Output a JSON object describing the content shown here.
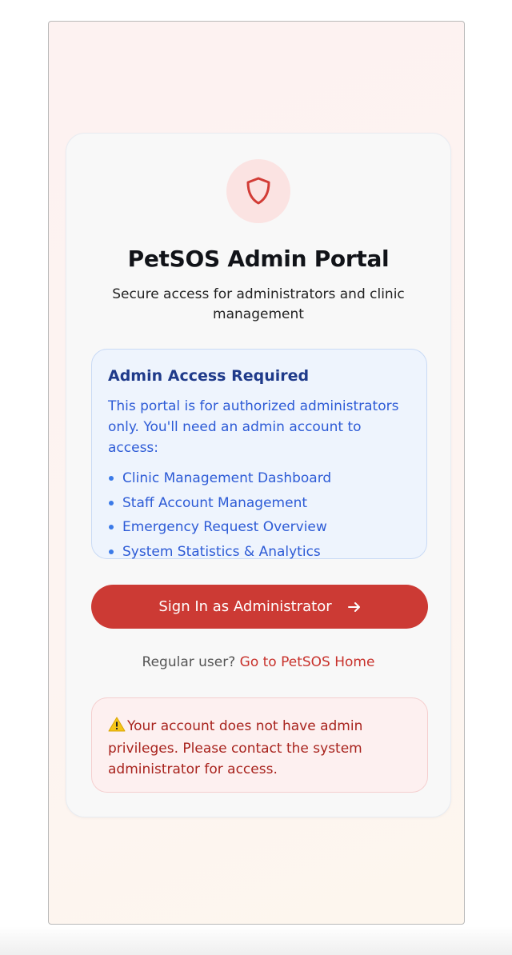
{
  "portal": {
    "title": "PetSOS Admin Portal",
    "subtitle": "Secure access for administrators and clinic management"
  },
  "info": {
    "heading": "Admin Access Required",
    "text": "This portal is for authorized administrators only. You'll need an admin account to access:",
    "items": [
      "Clinic Management Dashboard",
      "Staff Account Management",
      "Emergency Request Overview",
      "System Statistics & Analytics"
    ]
  },
  "signin": {
    "label": "Sign In as Administrator",
    "icon": "arrow-right-icon"
  },
  "regular": {
    "prompt": "Regular user?",
    "link": "Go to PetSOS Home"
  },
  "warning": {
    "icon": "warning-icon",
    "text": "Your account does not have admin privileges. Please contact the system administrator for access."
  },
  "colors": {
    "accent": "#cc3a34",
    "info_text": "#2d5bd6",
    "info_heading": "#1f3a8a",
    "warning_text": "#a8231d"
  }
}
